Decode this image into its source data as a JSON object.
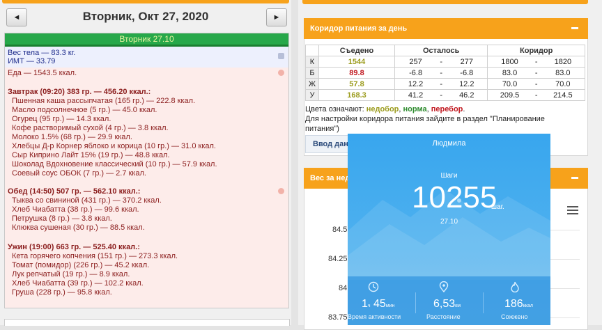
{
  "nav": {
    "prev_symbol": "◄",
    "next_symbol": "►",
    "date_title": "Вторник, Окт 27, 2020"
  },
  "day": {
    "header": "Вторник 27.10",
    "weight": "Вес тела — 83.3 кг.",
    "bmi": "ИМТ — 33.79",
    "food_total": "Еда — 1543.5 ккал.",
    "meals": [
      {
        "title": "Завтрак (09:20) 383 гр. — 456.20 ккал.:",
        "items": [
          "Пшенная каша рассыпчатая (165 гр.) — 222.8 ккал.",
          "Масло подсолнечное (5 гр.) — 45.0 ккал.",
          "Огурец (95 гр.) — 14.3 ккал.",
          "Кофе растворимый сухой (4 гр.) — 3.8 ккал.",
          "Молоко 1.5% (68 гр.) — 29.9 ккал.",
          "Хлебцы Д-р Корнер яблоко и корица (10 гр.) — 31.0 ккал.",
          "Сыр Киприно Лайт 15% (19 гр.) — 48.8 ккал.",
          "Шоколад Вдохновение классический (10 гр.) — 57.9 ккал.",
          "Соевый соус ОБОК (7 гр.) — 2.7 ккал."
        ]
      },
      {
        "title": "Обед (14:50) 507 гр. — 562.10 ккал.:",
        "items": [
          "Тыква со свининой (431 гр.) — 370.2 ккал.",
          "Хлеб Чиабатта (38 гр.) — 99.6 ккал.",
          "Петрушка (8 гр.) — 3.8 ккал.",
          "Клюква сушеная (30 гр.) — 88.5 ккал."
        ]
      },
      {
        "title": "Ужин (19:00) 663 гр. — 525.40 ккал.:",
        "items": [
          "Кета горячего копчения (151 гр.) — 273.3 ккал.",
          "Томат (помидор) (226 гр.) — 45.2 ккал.",
          "Лук репчатый (19 гр.) — 8.9 ккал.",
          "Хлеб Чиабатта (39 гр.) — 102.2 ккал.",
          "Груша (228 гр.) — 95.8 ккал."
        ]
      }
    ]
  },
  "corridor": {
    "title": "Коридор питания за день",
    "columns": [
      "Съедено",
      "Осталось",
      "Коридор"
    ],
    "rows": [
      {
        "label": "К",
        "eaten": "1544",
        "rem_min": "257",
        "rem_max": "277",
        "cor_min": "1800",
        "cor_max": "1820",
        "status": "under"
      },
      {
        "label": "Б",
        "eaten": "89.8",
        "rem_min": "-6.8",
        "rem_max": "-6.8",
        "cor_min": "83.0",
        "cor_max": "83.0",
        "status": "over"
      },
      {
        "label": "Ж",
        "eaten": "57.8",
        "rem_min": "12.2",
        "rem_max": "12.2",
        "cor_min": "70.0",
        "cor_max": "70.0",
        "status": "under"
      },
      {
        "label": "У",
        "eaten": "168.3",
        "rem_min": "41.2",
        "rem_max": "46.2",
        "cor_min": "209.5",
        "cor_max": "214.5",
        "status": "under"
      }
    ],
    "dash": "-",
    "legend_prefix": "Цвета означают: ",
    "legend_under": "недобор",
    "legend_sep1": ", ",
    "legend_norm": "норма",
    "legend_sep2": ", ",
    "legend_over": "перебор",
    "legend_end": ".",
    "settings_note_1": "Для настройки коридора питания зайдите в раздел \"Планирование",
    "settings_note_2": "питания\")",
    "enter_button": "Ввод дан"
  },
  "weight_panel": {
    "title": "Вес за нед",
    "y_ticks": [
      "84.5",
      "84.25",
      "84",
      "83.75"
    ]
  },
  "steps_overlay": {
    "user": "Людмила",
    "label": "Шаги",
    "steps": "10255",
    "unit": "шаг.",
    "date": "27.10",
    "activity_h": "1",
    "activity_h_unit": "ч",
    "activity_m": "45",
    "activity_m_unit": "мин",
    "activity_label": "Время активности",
    "distance": "6,53",
    "distance_unit": "км",
    "distance_label": "Расстояние",
    "calories": "186",
    "calories_unit": "ккал",
    "calories_label": "Сожжено"
  },
  "colors": {
    "accent_orange": "#f7a21b",
    "under": "#9b9b1c",
    "norm": "#2e8b2e",
    "over": "#c0161d",
    "day_header_green": "#27a84a",
    "overlay_blue": "#38a6ee"
  }
}
